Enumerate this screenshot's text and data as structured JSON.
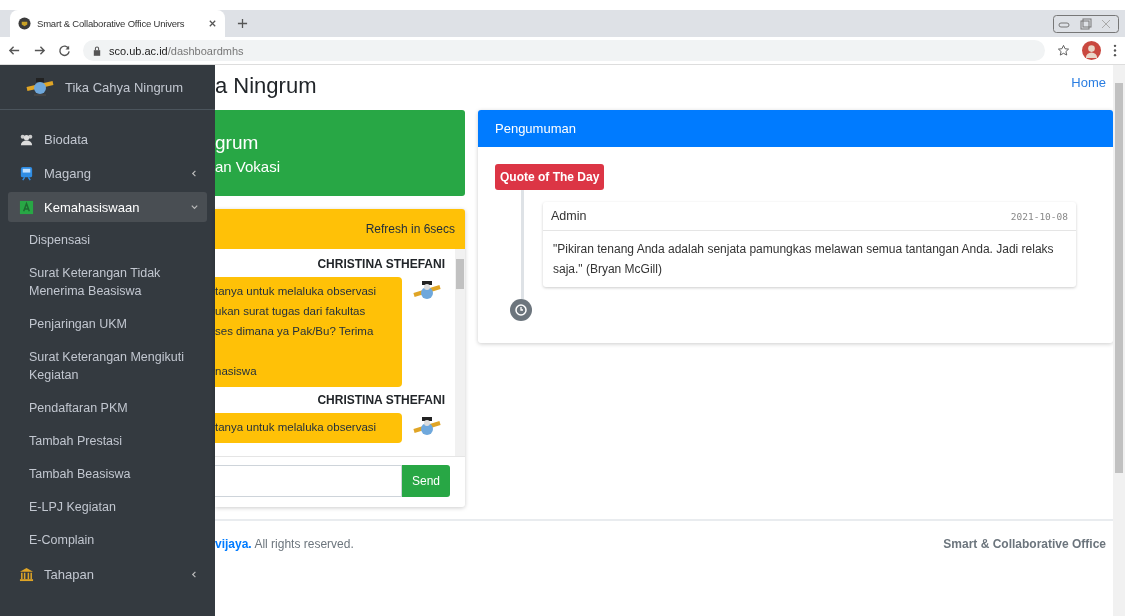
{
  "browser": {
    "tab_title": "Smart & Collaborative Office Univers",
    "url_host": "sco.ub.ac.id",
    "url_path": "/dashboardmhs"
  },
  "sidebar": {
    "user": "Tika Cahya Ningrum",
    "items": [
      {
        "kind": "menu",
        "label": "Biodata",
        "selected": false
      },
      {
        "kind": "menu",
        "label": "Magang",
        "selected": false,
        "expanded": false
      },
      {
        "kind": "menu",
        "label": "Kemahasiswaan",
        "selected": true,
        "expanded": true
      },
      {
        "kind": "sub",
        "label": "Dispensasi"
      },
      {
        "kind": "sub",
        "label": "Surat Keterangan Tidak Menerima Beasiswa"
      },
      {
        "kind": "sub",
        "label": "Penjaringan UKM"
      },
      {
        "kind": "sub",
        "label": "Surat Keterangan Mengikuti Kegiatan"
      },
      {
        "kind": "sub",
        "label": "Pendaftaran PKM"
      },
      {
        "kind": "sub",
        "label": "Tambah Prestasi"
      },
      {
        "kind": "sub",
        "label": "Tambah Beasiswa"
      },
      {
        "kind": "sub",
        "label": "E-LPJ Kegiatan"
      },
      {
        "kind": "sub",
        "label": "E-Complain"
      },
      {
        "kind": "menu",
        "label": "Tahapan",
        "selected": false,
        "expanded": false
      }
    ]
  },
  "page": {
    "title": "a Ningrum",
    "breadcrumb": "Home"
  },
  "profile_card": {
    "name": "grum",
    "faculty": "an Vokasi"
  },
  "chat": {
    "refresh": "Refresh in 6secs",
    "messages": [
      {
        "sender": "CHRISTINA STHEFANI",
        "text": "tanya untuk melaluka observasi\nukan surat tugas dari fakultas\nses dimana ya Pak/Bu? Terima\n\nnasiswa"
      },
      {
        "sender": "CHRISTINA STHEFANI",
        "text": "tanya untuk melaluka observasi"
      }
    ],
    "send": "Send"
  },
  "announcements": {
    "title": "Pengumuman",
    "label": "Quote of The Day",
    "entries": [
      {
        "author": "Admin",
        "date": "2021-10-08",
        "text": "\"Pikiran tenang Anda adalah senjata pamungkas melawan semua tantangan Anda. Jadi relaks saja.\" (Bryan McGill)"
      }
    ]
  },
  "footer": {
    "left": "**vijaya.** All rights reserved.",
    "right": "Smart & Collaborative Office"
  }
}
